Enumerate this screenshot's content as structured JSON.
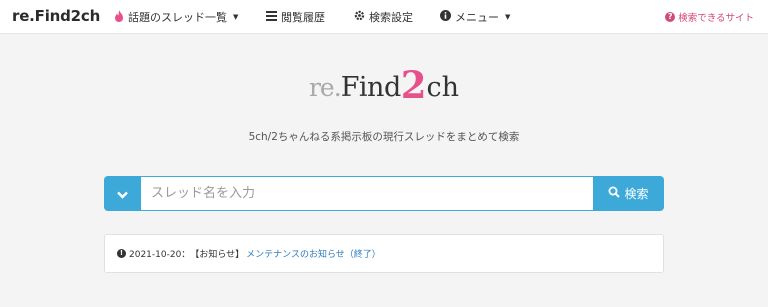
{
  "nav": {
    "brand": "re.Find2ch",
    "items": [
      {
        "label": "話題のスレッド一覧",
        "icon": "fire-icon",
        "dropdown": true
      },
      {
        "label": "閲覧履歴",
        "icon": "list-icon",
        "dropdown": false
      },
      {
        "label": "検索設定",
        "icon": "gear-icon",
        "dropdown": false
      },
      {
        "label": "メニュー",
        "icon": "info-icon",
        "dropdown": true
      }
    ],
    "right_link": "検索できるサイト"
  },
  "logo": {
    "re": "re.",
    "find": "Find",
    "two": "2",
    "ch": "ch"
  },
  "subtitle": "5ch/2ちゃんねる系掲示板の現行スレッドをまとめて検索",
  "search": {
    "placeholder": "スレッド名を入力",
    "value": "",
    "button_label": "検索"
  },
  "notice": {
    "date": "2021-10-20：",
    "tag": "【お知らせ】",
    "link": "メンテナンスのお知らせ（終了）"
  },
  "colors": {
    "accent": "#3da9d9",
    "pink": "#e8508c",
    "link": "#2e7dbd"
  }
}
